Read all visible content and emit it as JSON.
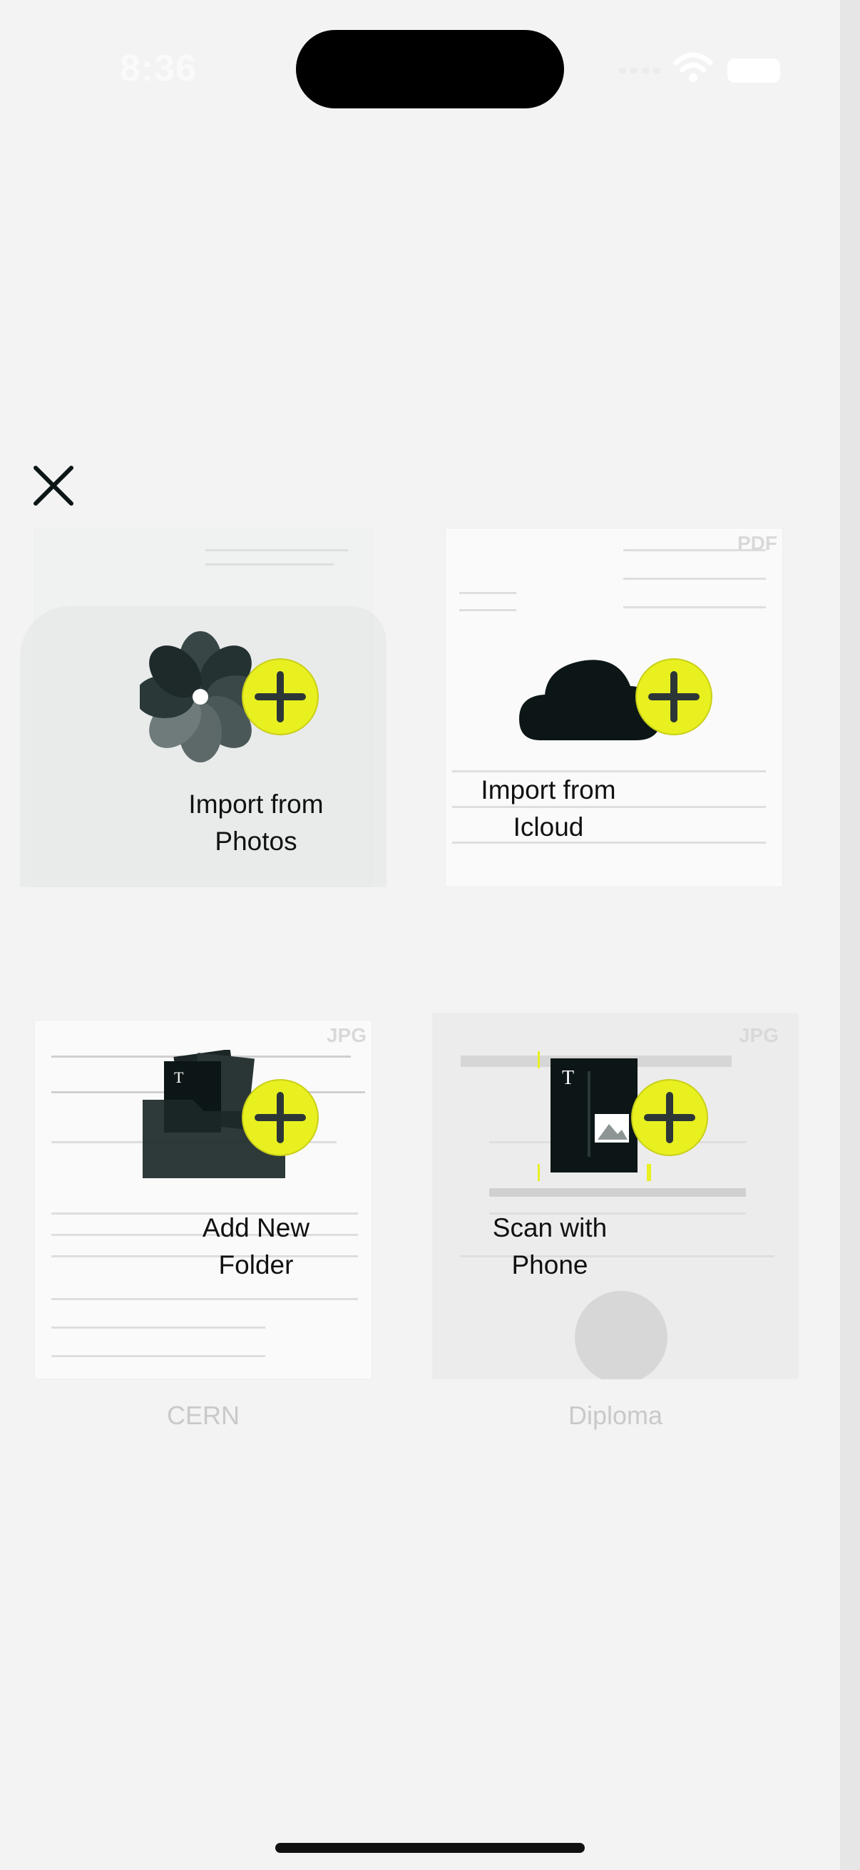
{
  "status_bar": {
    "time": "8:36"
  },
  "close_button": {
    "icon": "close-icon"
  },
  "actions": [
    {
      "line1": "Import from",
      "line2": "Photos",
      "icon": "photos-icon"
    },
    {
      "line1": "Import from",
      "line2": "Icloud",
      "icon": "cloud-icon",
      "file_type": "PDF"
    },
    {
      "line1": "Add New",
      "line2": "Folder",
      "icon": "folder-icon",
      "file_type": "JPG",
      "caption": "CERN"
    },
    {
      "line1": "Scan with",
      "line2": "Phone",
      "icon": "scan-document-icon",
      "file_type": "JPG",
      "caption": "Diploma"
    }
  ],
  "colors": {
    "accent": "#e8f020",
    "icon_dark": "#0c1616",
    "caption": "#c9c9c9"
  }
}
